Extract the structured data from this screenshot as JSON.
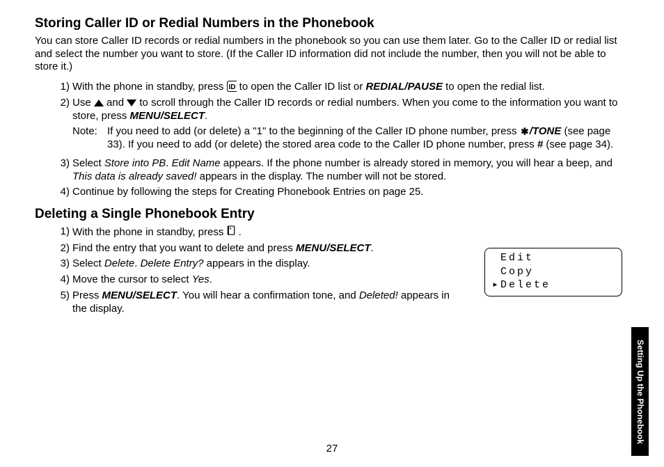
{
  "section1": {
    "heading": "Storing Caller ID or Redial Numbers in the Phonebook",
    "intro": "You can store Caller ID records or redial numbers in the phonebook so you can use them later. Go to the Caller ID or redial list and select the number you want to store. (If the Caller ID information did not include the number, then you will not be able to store it.)",
    "steps": [
      {
        "num": "1)",
        "t1": "With the phone in standby, press ",
        "t2": " to open the Caller ID list or ",
        "redial": "REDIAL/PAUSE",
        "t3": " to open the redial list."
      },
      {
        "num": "2)",
        "t1": "Use ",
        "t2": " and ",
        "t3": " to scroll through the Caller ID records or redial numbers. When you come to the information you want to store, press ",
        "menu": "MENU/SELECT",
        "t4": ".",
        "note_label": "Note:",
        "note_t1": "If you need to add (or delete) a \"1\" to the beginning of the Caller ID phone number, press ",
        "tone": "/TONE",
        "note_t2": " (see page 33). If you need to add (or delete) the stored area code to the Caller ID phone number, press ",
        "hash": "#",
        "note_t3": " (see page 34)."
      },
      {
        "num": "3)",
        "t1": "Select ",
        "store": "Store into PB",
        "t2": ". ",
        "edit": "Edit Name",
        "t3": " appears. If the phone number is already stored in memory, you will hear a beep, and ",
        "saved": "This data is already saved!",
        "t4": " appears in the display. The number will not be stored."
      },
      {
        "num": "4)",
        "t1": "Continue by following the steps for Creating Phonebook Entries on page 25."
      }
    ]
  },
  "section2": {
    "heading": "Deleting a Single Phonebook Entry",
    "steps": [
      {
        "num": "1)",
        "t1": "With the phone in standby, press ",
        "t2": " ."
      },
      {
        "num": "2)",
        "t1": "Find the entry that you want to delete and press ",
        "menu": "MENU/SELECT",
        "t2": "."
      },
      {
        "num": "3)",
        "t1": "Select ",
        "del": "Delete",
        "t2": ". ",
        "delq": "Delete Entry?",
        "t3": " appears in the display."
      },
      {
        "num": "4)",
        "t1": "Move the cursor to select ",
        "yes": "Yes",
        "t2": "."
      },
      {
        "num": "5)",
        "t1": "Press ",
        "menu": "MENU/SELECT",
        "t2": ". You will hear a confirmation tone, and ",
        "deleted": "Deleted!",
        "t3": " appears in the display."
      }
    ]
  },
  "lcd": {
    "line1": "Edit",
    "line2": "Copy",
    "line3": "Delete"
  },
  "page_number": "27",
  "side_tab": "Setting Up the Phonebook"
}
